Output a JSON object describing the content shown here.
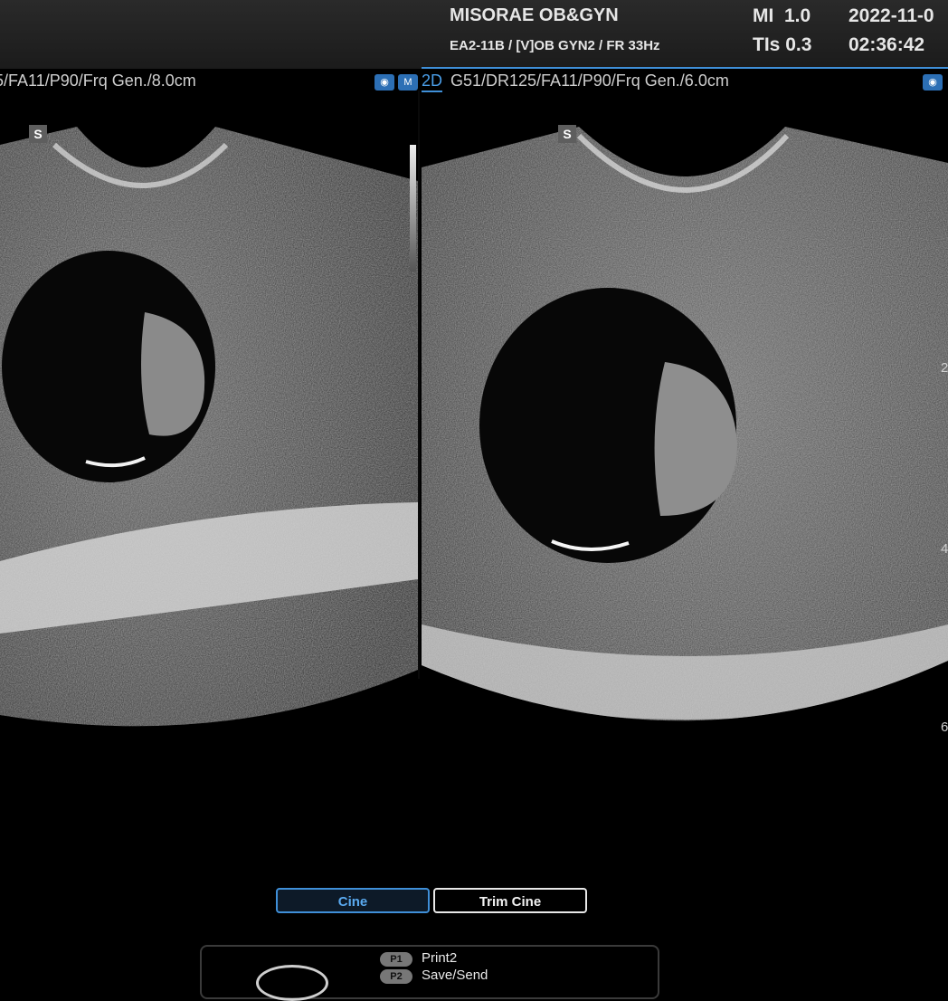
{
  "header": {
    "clinic": "MISORAE OB&GYN",
    "probe_info": "EA2-11B / [V]OB GYN2 / FR 33Hz",
    "mi_label": "MI",
    "mi_value": "1.0",
    "tis_label": "TIs",
    "tis_value": "0.3",
    "date": "2022-11-0",
    "time": "02:36:42"
  },
  "left_image": {
    "params": "5/FA11/P90/Frq Gen./8.0cm",
    "marker": "S"
  },
  "right_image": {
    "mode": "2D",
    "params": "G51/DR125/FA11/P90/Frq Gen./6.0cm",
    "marker": "S"
  },
  "icons": [
    "probe-icon",
    "mode-icon",
    "probe-icon-right"
  ],
  "depth_scale": [
    "2",
    "4",
    "6"
  ],
  "buttons": {
    "cine": "Cine",
    "trim_cine": "Trim Cine"
  },
  "soft_keys": [
    {
      "key": "P1",
      "label": "Print2"
    },
    {
      "key": "P2",
      "label": "Save/Send"
    }
  ],
  "colors": {
    "accent": "#3f8fd8",
    "background": "#000000"
  }
}
